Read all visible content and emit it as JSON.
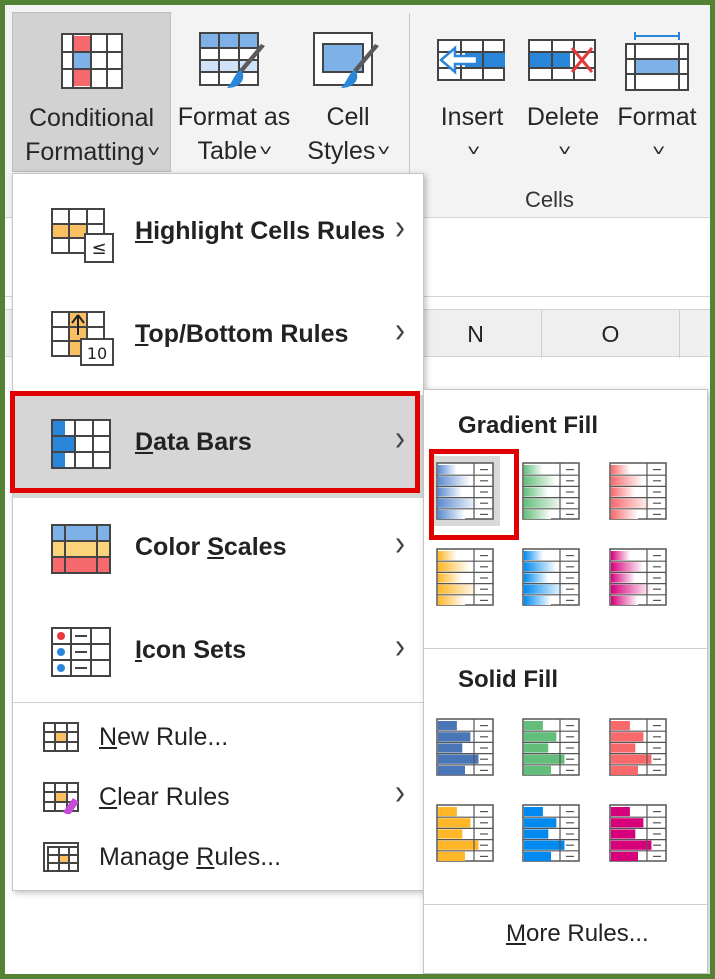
{
  "ribbon": {
    "conditional_formatting": {
      "line1": "Conditional",
      "line2": "Formatting",
      "icon": "conditional-formatting-icon"
    },
    "format_as_table": {
      "line1": "Format as",
      "line2": "Table",
      "icon": "format-as-table-icon"
    },
    "cell_styles": {
      "line1": "Cell",
      "line2": "Styles",
      "icon": "cell-styles-icon"
    },
    "insert": {
      "label": "Insert",
      "icon": "insert-cells-icon"
    },
    "delete": {
      "label": "Delete",
      "icon": "delete-cells-icon"
    },
    "format": {
      "label": "Format",
      "icon": "format-cells-icon"
    },
    "cells_group_label": "Cells"
  },
  "sheet": {
    "columns": [
      "N",
      "O"
    ]
  },
  "menu": {
    "items": [
      {
        "pre": "",
        "ul": "H",
        "post": "ighlight Cells Rules",
        "icon": "highlight-cells-rules-icon",
        "has_submenu": true
      },
      {
        "pre": "",
        "ul": "T",
        "post": "op/Bottom Rules",
        "icon": "top-bottom-rules-icon",
        "has_submenu": true
      },
      {
        "pre": "",
        "ul": "D",
        "post": "ata Bars",
        "icon": "data-bars-icon",
        "has_submenu": true,
        "active": true
      },
      {
        "pre": "Color ",
        "ul": "S",
        "post": "cales",
        "icon": "color-scales-icon",
        "has_submenu": true
      },
      {
        "pre": "",
        "ul": "I",
        "post": "con Sets",
        "icon": "icon-sets-icon",
        "has_submenu": true
      }
    ],
    "secondary": [
      {
        "pre": "",
        "ul": "N",
        "post": "ew Rule...",
        "icon": "new-rule-icon",
        "has_submenu": false
      },
      {
        "pre": "",
        "ul": "C",
        "post": "lear Rules",
        "icon": "clear-rules-icon",
        "has_submenu": true
      },
      {
        "pre": "Manage ",
        "ul": "R",
        "post": "ules...",
        "icon": "manage-rules-icon",
        "has_submenu": false
      }
    ]
  },
  "submenu": {
    "gradient_heading": "Gradient Fill",
    "solid_heading": "Solid Fill",
    "more_rules": {
      "pre": "",
      "ul": "M",
      "post": "ore Rules..."
    },
    "gradient_colors": [
      "#5b8bd0",
      "#63be7b",
      "#f8696b",
      "#ffb628",
      "#008aef",
      "#d6007b"
    ],
    "solid_colors": [
      "#4a76b8",
      "#63be7b",
      "#f8696b",
      "#ffb628",
      "#008aef",
      "#d6007b"
    ],
    "selected_index": 0
  },
  "colors": {
    "frame_border": "#548235",
    "highlight_red": "#e00000"
  }
}
